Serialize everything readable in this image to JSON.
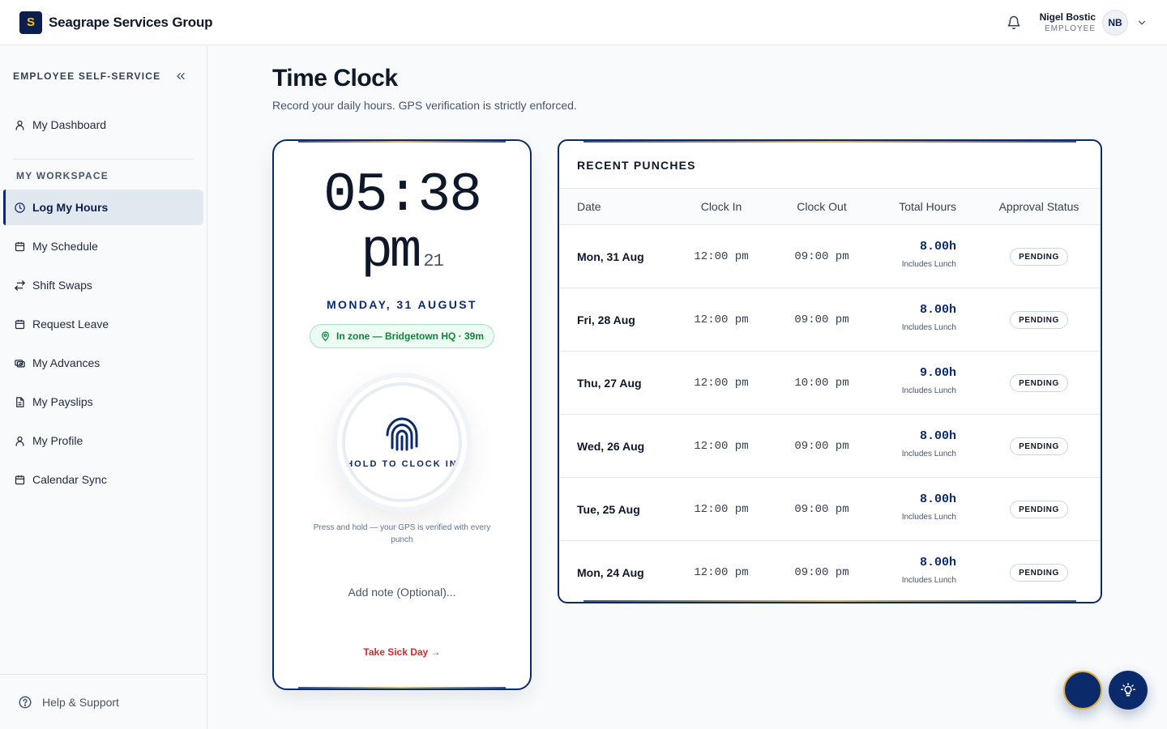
{
  "header": {
    "logo_letter": "S",
    "brand": "Seagrape Services Group",
    "user_name": "Nigel Bostic",
    "user_role": "EMPLOYEE",
    "user_initials": "NB"
  },
  "sidebar": {
    "title": "EMPLOYEE SELF-SERVICE",
    "top_items": [
      {
        "label": "My Dashboard",
        "icon": "user-icon"
      }
    ],
    "section_label": "MY WORKSPACE",
    "items": [
      {
        "label": "Log My Hours",
        "icon": "clock-icon",
        "active": true
      },
      {
        "label": "My Schedule",
        "icon": "calendar-icon"
      },
      {
        "label": "Shift Swaps",
        "icon": "swap-icon"
      },
      {
        "label": "Request Leave",
        "icon": "calendar-icon"
      },
      {
        "label": "My Advances",
        "icon": "cash-icon"
      },
      {
        "label": "My Payslips",
        "icon": "document-icon"
      },
      {
        "label": "My Profile",
        "icon": "user-icon"
      },
      {
        "label": "Calendar Sync",
        "icon": "calendar-icon"
      }
    ],
    "help_label": "Help & Support"
  },
  "page": {
    "title": "Time Clock",
    "subtitle": "Record your daily hours. GPS verification is strictly enforced."
  },
  "clock": {
    "time": "05:38",
    "ampm": "pm",
    "seconds": "21",
    "date": "MONDAY, 31 AUGUST",
    "zone": "In zone — Bridgetown HQ · 39m",
    "button_label": "HOLD TO CLOCK IN",
    "hint": "Press and hold — your GPS is verified with every punch",
    "note_placeholder": "Add note (Optional)...",
    "sick_link": "Take Sick Day →"
  },
  "punches": {
    "title": "RECENT PUNCHES",
    "columns": [
      "Date",
      "Clock In",
      "Clock Out",
      "Total Hours",
      "Approval Status"
    ],
    "rows": [
      {
        "date": "Mon, 31 Aug",
        "in": "12:00 pm",
        "out": "09:00 pm",
        "total": "8.00h",
        "note": "Includes Lunch",
        "status": "PENDING"
      },
      {
        "date": "Fri, 28 Aug",
        "in": "12:00 pm",
        "out": "09:00 pm",
        "total": "8.00h",
        "note": "Includes Lunch",
        "status": "PENDING"
      },
      {
        "date": "Thu, 27 Aug",
        "in": "12:00 pm",
        "out": "10:00 pm",
        "total": "9.00h",
        "note": "Includes Lunch",
        "status": "PENDING"
      },
      {
        "date": "Wed, 26 Aug",
        "in": "12:00 pm",
        "out": "09:00 pm",
        "total": "8.00h",
        "note": "Includes Lunch",
        "status": "PENDING"
      },
      {
        "date": "Tue, 25 Aug",
        "in": "12:00 pm",
        "out": "09:00 pm",
        "total": "8.00h",
        "note": "Includes Lunch",
        "status": "PENDING"
      },
      {
        "date": "Mon, 24 Aug",
        "in": "12:00 pm",
        "out": "09:00 pm",
        "total": "8.00h",
        "note": "Includes Lunch",
        "status": "PENDING"
      }
    ]
  },
  "colors": {
    "navy": "#0b2a6b",
    "gold": "#e0b13a",
    "zone_green": "#15803d",
    "sick_red": "#dc2626"
  },
  "fabs": [
    {
      "icon": "accessibility-icon"
    },
    {
      "icon": "lightbulb-icon"
    }
  ]
}
